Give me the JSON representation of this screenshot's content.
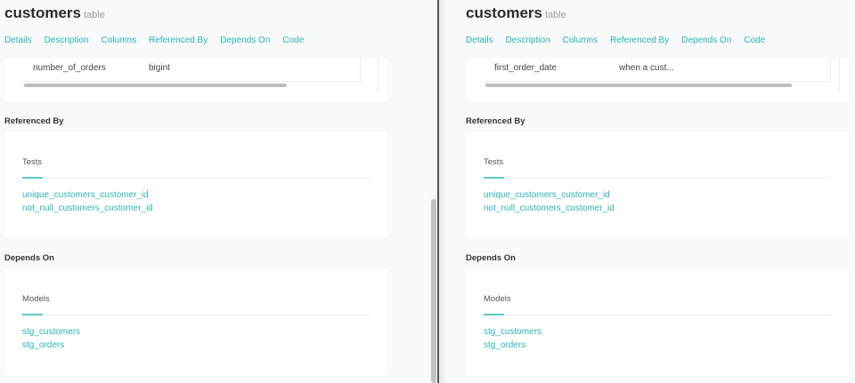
{
  "left": {
    "title": "customers",
    "subtitle": "table",
    "tabs": [
      "Details",
      "Description",
      "Columns",
      "Referenced By",
      "Depends On",
      "Code"
    ],
    "column": {
      "name": "number_of_orders",
      "value": "bigint"
    },
    "referenced_by": {
      "heading": "Referenced By",
      "group": "Tests",
      "items": [
        "unique_customers_customer_id",
        "not_null_customers_customer_id"
      ]
    },
    "depends_on": {
      "heading": "Depends On",
      "group": "Models",
      "items": [
        "stg_customers",
        "stg_orders"
      ]
    }
  },
  "right": {
    "title": "customers",
    "subtitle": "table",
    "tabs": [
      "Details",
      "Description",
      "Columns",
      "Referenced By",
      "Depends On",
      "Code"
    ],
    "column": {
      "name": "first_order_date",
      "value": "when a cust..."
    },
    "referenced_by": {
      "heading": "Referenced By",
      "group": "Tests",
      "items": [
        "unique_customers_customer_id",
        "not_null_customers_customer_id"
      ]
    },
    "depends_on": {
      "heading": "Depends On",
      "group": "Models",
      "items": [
        "stg_customers",
        "stg_orders"
      ]
    }
  }
}
